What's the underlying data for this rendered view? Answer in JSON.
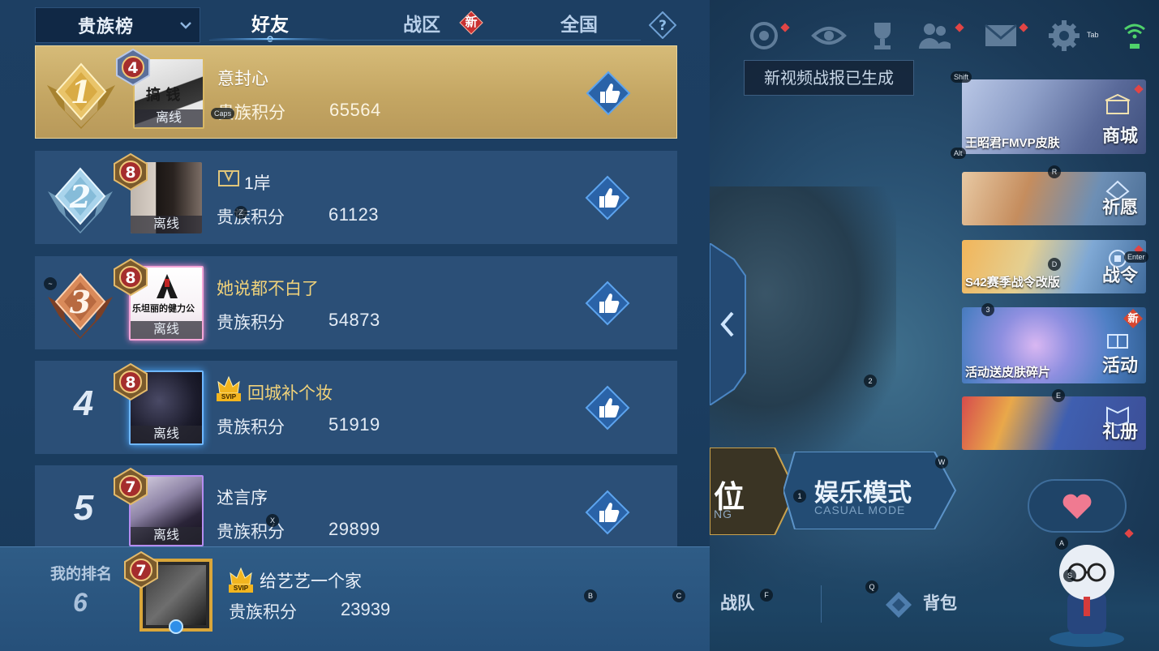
{
  "tabs": {
    "dropdown_label": "贵族榜",
    "friends": "好友",
    "zone": "战区",
    "zone_badge": "新",
    "national": "全国"
  },
  "status_word": "离线",
  "score_label": "贵族积分",
  "rows": [
    {
      "rank": "1",
      "level": "4",
      "name": "意封心",
      "score": "65564"
    },
    {
      "rank": "2",
      "level": "8",
      "name": "1岸",
      "score": "61123"
    },
    {
      "rank": "3",
      "level": "8",
      "name": "她说都不白了",
      "score": "54873"
    },
    {
      "rank": "4",
      "level": "8",
      "name": "回城补个妆",
      "score": "51919",
      "svip": "SVIP"
    },
    {
      "rank": "5",
      "level": "7",
      "name": "述言序",
      "score": "29899"
    }
  ],
  "my_rank": {
    "label": "我的排名",
    "rank": "6",
    "level": "7",
    "name": "给艺艺一个家",
    "score": "23939",
    "svip": "SVIP"
  },
  "toast": "新视频战报已生成",
  "cards": [
    {
      "title": "商城",
      "subtitle": "王昭君FMVP皮肤"
    },
    {
      "title": "祈愿",
      "subtitle": ""
    },
    {
      "title": "战令",
      "subtitle": "S42赛季战令改版"
    },
    {
      "title": "活动",
      "subtitle": "活动送皮肤碎片",
      "badge": "新"
    },
    {
      "title": "礼册",
      "subtitle": ""
    }
  ],
  "modes": {
    "ranked_char": "位",
    "ranked_sub": "NG",
    "casual": "娱乐模式",
    "casual_sub": "CASUAL MODE"
  },
  "bottom": {
    "team": "战队",
    "bag": "背包"
  },
  "key_hints": {
    "tab": "Tab",
    "shift": "Shift",
    "alt": "Alt",
    "r": "R",
    "d": "D",
    "enter": "Enter",
    "three": "3",
    "two": "2",
    "e": "E",
    "w": "W",
    "one": "1",
    "a": "A",
    "s": "S",
    "q": "Q",
    "f": "F",
    "b": "B",
    "c": "C",
    "x": "X",
    "z": "Z",
    "caps": "Caps",
    "tilde": "~"
  },
  "avatar_text": {
    "row1": "搞 钱",
    "row3": "乐坦丽的健力公"
  },
  "colors": {
    "panel": "#1d3f63",
    "row": "#2b4f77",
    "gold_row": "#c4a663",
    "accent_blue": "#3e86d6",
    "badge_red": "#d33a3a"
  }
}
